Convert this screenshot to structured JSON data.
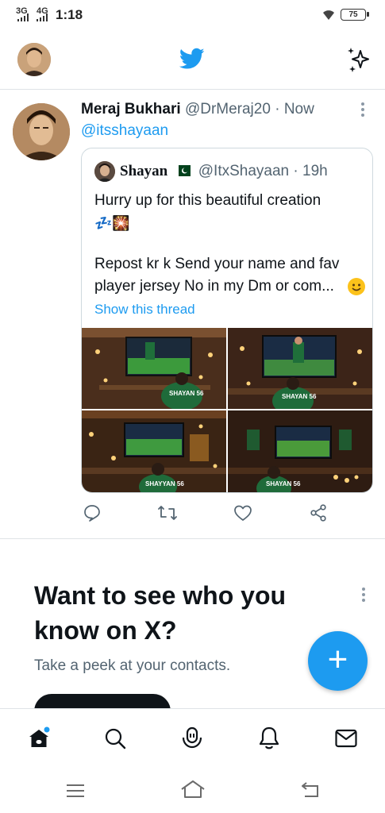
{
  "status_bar": {
    "signal_1": "3G",
    "signal_2": "4G",
    "time": "1:18",
    "battery": "75"
  },
  "header": {
    "logo_icon": "twitter-bird-icon",
    "sparkle_icon": "sparkle-icon"
  },
  "tweet": {
    "author_name": "Meraj Bukhari",
    "author_handle": "@DrMeraj20",
    "separator": "·",
    "time": "Now",
    "reply_to": "@itsshayaan",
    "quoted": {
      "author_name": "Shayan",
      "author_handle": "@ItxShayaan",
      "separator": "·",
      "time": "19h",
      "line1": "Hurry up for this beautiful creation",
      "emoji_line": "💤🎇",
      "line2": "Repost kr k Send your name and fav",
      "line3": "player jersey No in my Dm or com...",
      "show_thread": "Show this thread",
      "images": [
        "SHAYAN 56",
        "SHAYAN 56",
        "SHAYYAN 56",
        "SHAYAN 56"
      ]
    },
    "actions": [
      "reply-icon",
      "retweet-icon",
      "like-icon",
      "share-icon"
    ]
  },
  "suggestion": {
    "title_line1": "Want to see who you",
    "title_line2": "know on X?",
    "subtitle": "Take a peek at your contacts."
  },
  "fab_label": "+",
  "bottom_nav": [
    "home-icon",
    "search-icon",
    "spaces-icon",
    "notifications-icon",
    "messages-icon"
  ],
  "colors": {
    "accent": "#1d9bf0",
    "text": "#0f1419",
    "muted": "#536471"
  }
}
